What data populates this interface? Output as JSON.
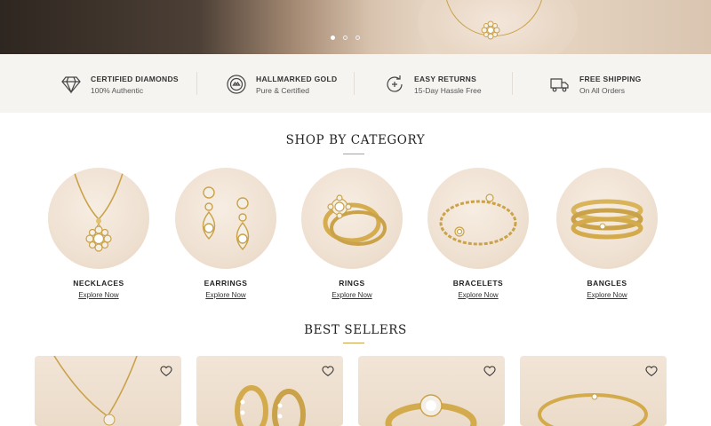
{
  "hero": {
    "slides": [
      {
        "active": true
      },
      {
        "active": false
      },
      {
        "active": false
      }
    ]
  },
  "features": [
    {
      "icon": "diamond-icon",
      "title": "CERTIFIED DIAMONDS",
      "subtitle": "100% Authentic"
    },
    {
      "icon": "hallmark-badge-icon",
      "title": "HALLMARKED GOLD",
      "subtitle": "Pure & Certified"
    },
    {
      "icon": "returns-icon",
      "title": "EASY RETURNS",
      "subtitle": "15-Day Hassle Free"
    },
    {
      "icon": "delivery-truck-icon",
      "title": "FREE SHIPPING",
      "subtitle": "On All Orders"
    }
  ],
  "category_section": {
    "title": "SHOP BY CATEGORY",
    "items": [
      {
        "label": "NECKLACES",
        "link": "Explore Now"
      },
      {
        "label": "EARRINGS",
        "link": "Explore Now"
      },
      {
        "label": "RINGS",
        "link": "Explore Now"
      },
      {
        "label": "BRACELETS",
        "link": "Explore Now"
      },
      {
        "label": "BANGLES",
        "link": "Explore Now"
      }
    ]
  },
  "bestsellers": {
    "title": "BEST SELLERS",
    "cards": [
      {
        "image": "necklace-pendant",
        "wishlist_icon": "heart-icon"
      },
      {
        "image": "hoop-earrings",
        "wishlist_icon": "heart-icon"
      },
      {
        "image": "solitaire-ring",
        "wishlist_icon": "heart-icon"
      },
      {
        "image": "gold-bangle",
        "wishlist_icon": "heart-icon"
      }
    ]
  },
  "colors": {
    "accent_gold": "#c9a24a",
    "strip_background": "#f6f4f1",
    "text_dark": "#222222"
  }
}
